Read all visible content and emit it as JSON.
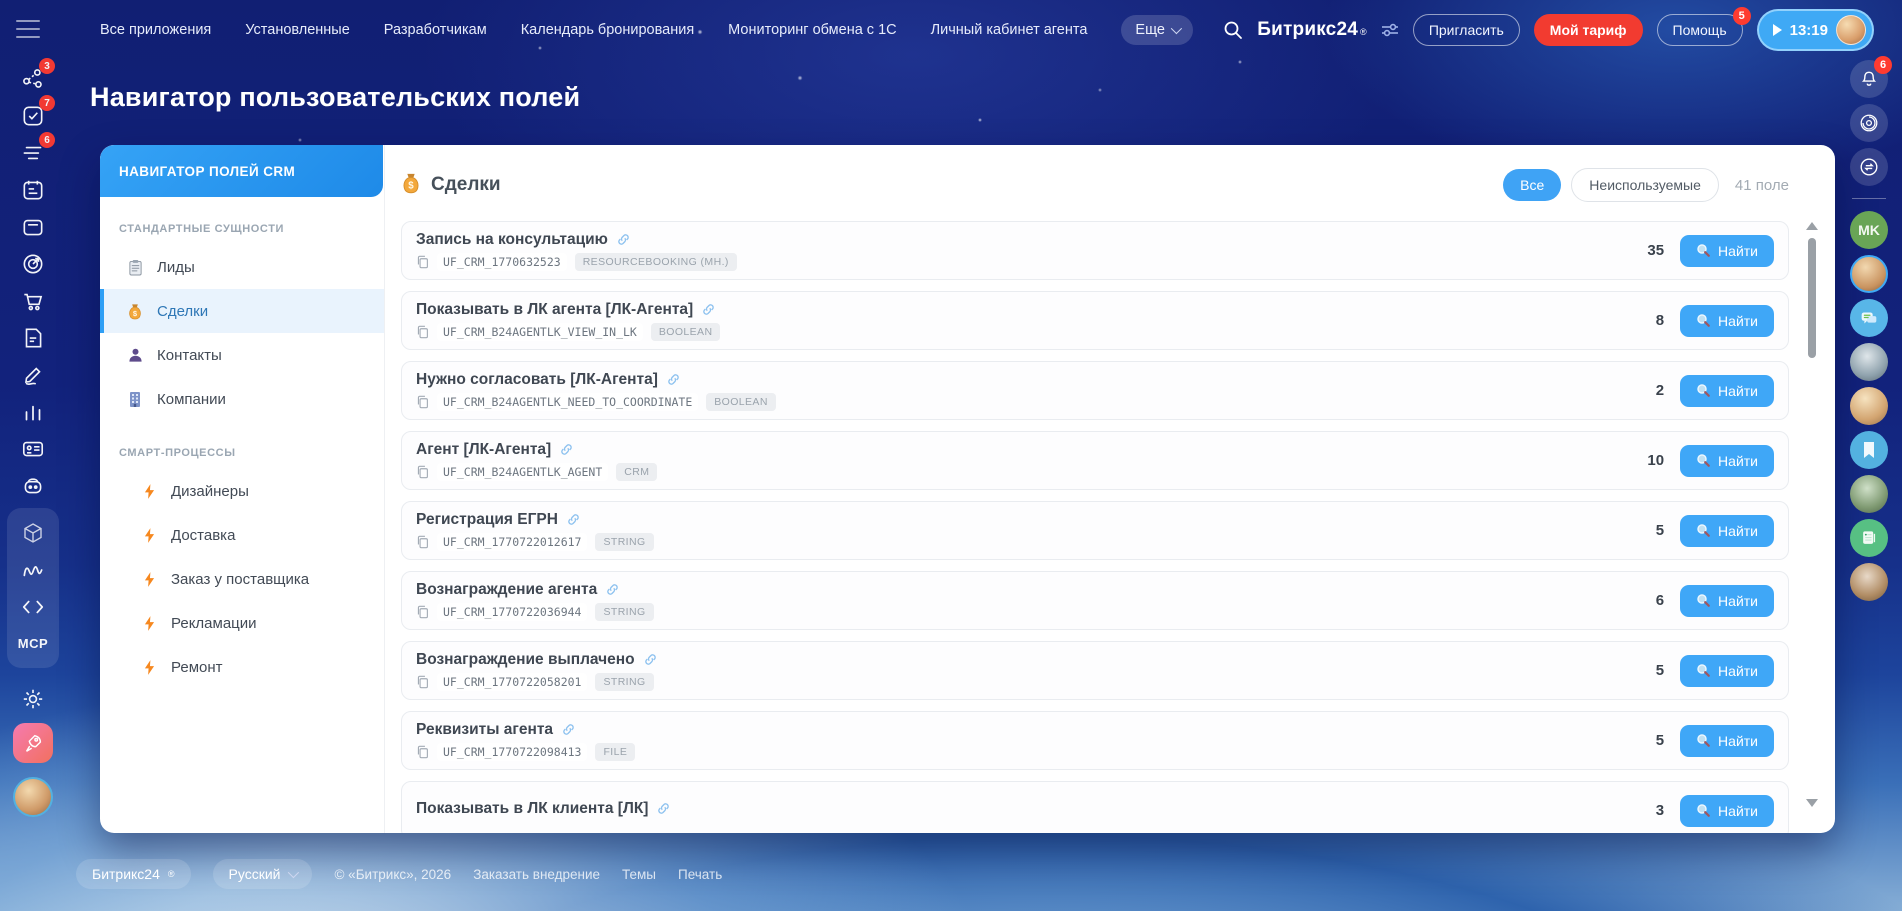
{
  "topbar": {
    "menu": [
      "Все приложения",
      "Установленные",
      "Разработчикам",
      "Календарь бронирования",
      "Мониторинг обмена с 1С",
      "Личный кабинет агента"
    ],
    "more_label": "Еще",
    "brand": "Битрикс24",
    "brand_reg": "®",
    "invite_label": "Пригласить",
    "tariff_label": "Мой тариф",
    "help_label": "Помощь",
    "help_badge": "5",
    "timer": "13:19"
  },
  "left_rail": {
    "network_badge": "3",
    "tasks_badge": "7",
    "feed_badge": "6",
    "mcp_label": "MCP"
  },
  "right_rail": {
    "bell_badge": "6",
    "avatar_initials": "MK"
  },
  "page": {
    "title": "Навигатор пользовательских полей"
  },
  "panel": {
    "header": "НАВИГАТОР ПОЛЕЙ CRM",
    "sections": [
      {
        "label": "СТАНДАРТНЫЕ СУЩНОСТИ",
        "items": [
          {
            "label": "Лиды"
          },
          {
            "label": "Сделки",
            "selected": true
          },
          {
            "label": "Контакты"
          },
          {
            "label": "Компании"
          }
        ]
      },
      {
        "label": "СМАРТ-ПРОЦЕССЫ",
        "items": [
          {
            "label": "Дизайнеры"
          },
          {
            "label": "Доставка"
          },
          {
            "label": "Заказ у поставщика"
          },
          {
            "label": "Рекламации"
          },
          {
            "label": "Ремонт"
          }
        ]
      }
    ]
  },
  "content": {
    "title": "Сделки",
    "filter_all": "Все",
    "filter_unused": "Неиспользуемые",
    "field_count": "41 поле",
    "find_label": "Найти",
    "fields": [
      {
        "name": "Запись на консультацию",
        "code": "UF_CRM_1770632523",
        "type": "RESOURCEBOOKING (МН.)",
        "count": "35"
      },
      {
        "name": "Показывать в ЛК агента [ЛК-Агента]",
        "code": "UF_CRM_B24AGENTLK_VIEW_IN_LK",
        "type": "BOOLEAN",
        "count": "8"
      },
      {
        "name": "Нужно согласовать [ЛК-Агента]",
        "code": "UF_CRM_B24AGENTLK_NEED_TO_COORDINATE",
        "type": "BOOLEAN",
        "count": "2"
      },
      {
        "name": "Агент [ЛК-Агента]",
        "code": "UF_CRM_B24AGENTLK_AGENT",
        "type": "CRM",
        "count": "10"
      },
      {
        "name": "Регистрация ЕГРН",
        "code": "UF_CRM_1770722012617",
        "type": "STRING",
        "count": "5"
      },
      {
        "name": "Вознаграждение агента",
        "code": "UF_CRM_1770722036944",
        "type": "STRING",
        "count": "6"
      },
      {
        "name": "Вознаграждение выплачено",
        "code": "UF_CRM_1770722058201",
        "type": "STRING",
        "count": "5"
      },
      {
        "name": "Реквизиты агента",
        "code": "UF_CRM_1770722098413",
        "type": "FILE",
        "count": "5"
      },
      {
        "name": "Показывать в ЛК клиента [ЛК]",
        "code": "",
        "type": "",
        "count": "3"
      }
    ]
  },
  "footer": {
    "brand": "Битрикс24",
    "brand_reg": "®",
    "language": "Русский",
    "copyright": "© «Битрикс», 2026",
    "links": [
      "Заказать внедрение",
      "Темы",
      "Печать"
    ]
  },
  "colors": {
    "accent_blue": "#3fa3f5",
    "danger_red": "#f23b30",
    "selected_item_bg": "#e9f3fd",
    "topbar_bg": "#12227c"
  }
}
